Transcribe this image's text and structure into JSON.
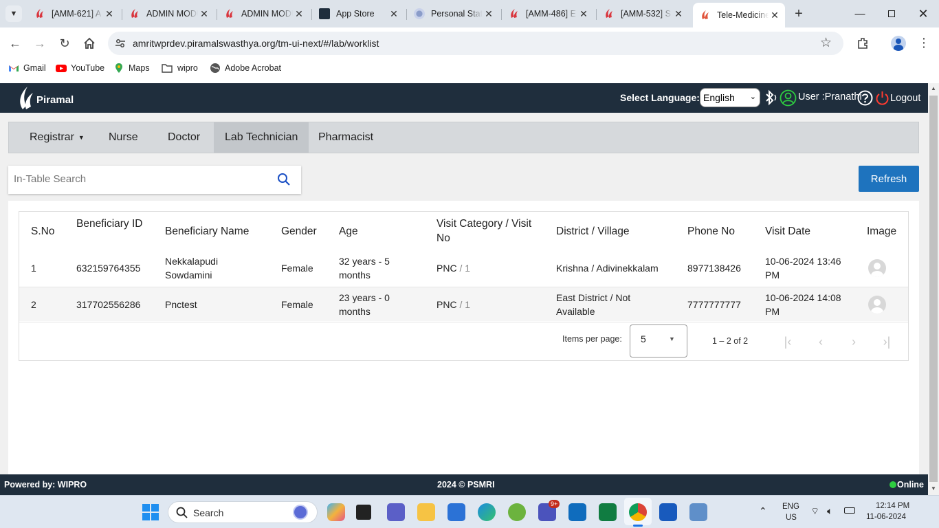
{
  "browser": {
    "tabs": [
      {
        "title": "[AMM-621] A",
        "icon": "piramal-logo"
      },
      {
        "title": "ADMIN MODULE",
        "icon": "piramal-logo"
      },
      {
        "title": "ADMIN MODULE",
        "icon": "piramal-logo"
      },
      {
        "title": "App Store",
        "icon": "app-store"
      },
      {
        "title": "Personal Stat",
        "icon": "personal-stats"
      },
      {
        "title": "[AMM-486] E",
        "icon": "piramal-logo"
      },
      {
        "title": "[AMM-532] S",
        "icon": "piramal-logo"
      },
      {
        "title": "Tele-Medicine",
        "icon": "piramal-logo",
        "active": true
      }
    ],
    "url": "amritwprdev.piramalswasthya.org/tm-ui-next/#/lab/worklist",
    "bookmarks": [
      "Gmail",
      "YouTube",
      "Maps",
      "wipro",
      "Adobe Acrobat"
    ]
  },
  "app": {
    "brand": "Piramal",
    "select_language_label": "Select Language:",
    "language": "English",
    "user_label": "User :Pranathi",
    "logout_label": "Logout",
    "roles": [
      "Registrar",
      "Nurse",
      "Doctor",
      "Lab Technician",
      "Pharmacist"
    ],
    "active_role": "Lab Technician",
    "search_placeholder": "In-Table Search",
    "refresh_label": "Refresh",
    "table": {
      "headers": {
        "sno": "S.No",
        "ben_id": "Beneficiary ID",
        "ben_name": "Beneficiary Name",
        "gender": "Gender",
        "age": "Age",
        "visit": "Visit Category / Visit No",
        "district": "District / Village",
        "phone": "Phone No",
        "visit_date": "Visit Date",
        "image": "Image"
      },
      "rows": [
        {
          "sno": "1",
          "ben_id": "632159764355",
          "ben_name": "Nekkalapudi Sowdamini",
          "gender": "Female",
          "age": "32 years - 5 months",
          "visit_cat": "PNC",
          "visit_no": "1",
          "district": "Krishna / Adivinekkalam",
          "phone": "8977138426",
          "visit_date": "10-06-2024 13:46 PM"
        },
        {
          "sno": "2",
          "ben_id": "317702556286",
          "ben_name": "Pnctest",
          "gender": "Female",
          "age": "23 years - 0 months",
          "visit_cat": "PNC",
          "visit_no": "1",
          "district": "East District / Not Available",
          "phone": "7777777777",
          "visit_date": "10-06-2024 14:08 PM"
        }
      ]
    },
    "paginator": {
      "items_per_page_label": "Items per page:",
      "page_size": "5",
      "range_label": "1 – 2 of 2"
    },
    "footer": {
      "powered_by": "Powered by: WIPRO",
      "copyright": "2024 © PSMRI",
      "status": "Online"
    }
  },
  "taskbar": {
    "search_label": "Search",
    "lang_line1": "ENG",
    "lang_line2": "US",
    "time": "12:14 PM",
    "date": "11-06-2024",
    "teams_badge": "9+"
  }
}
